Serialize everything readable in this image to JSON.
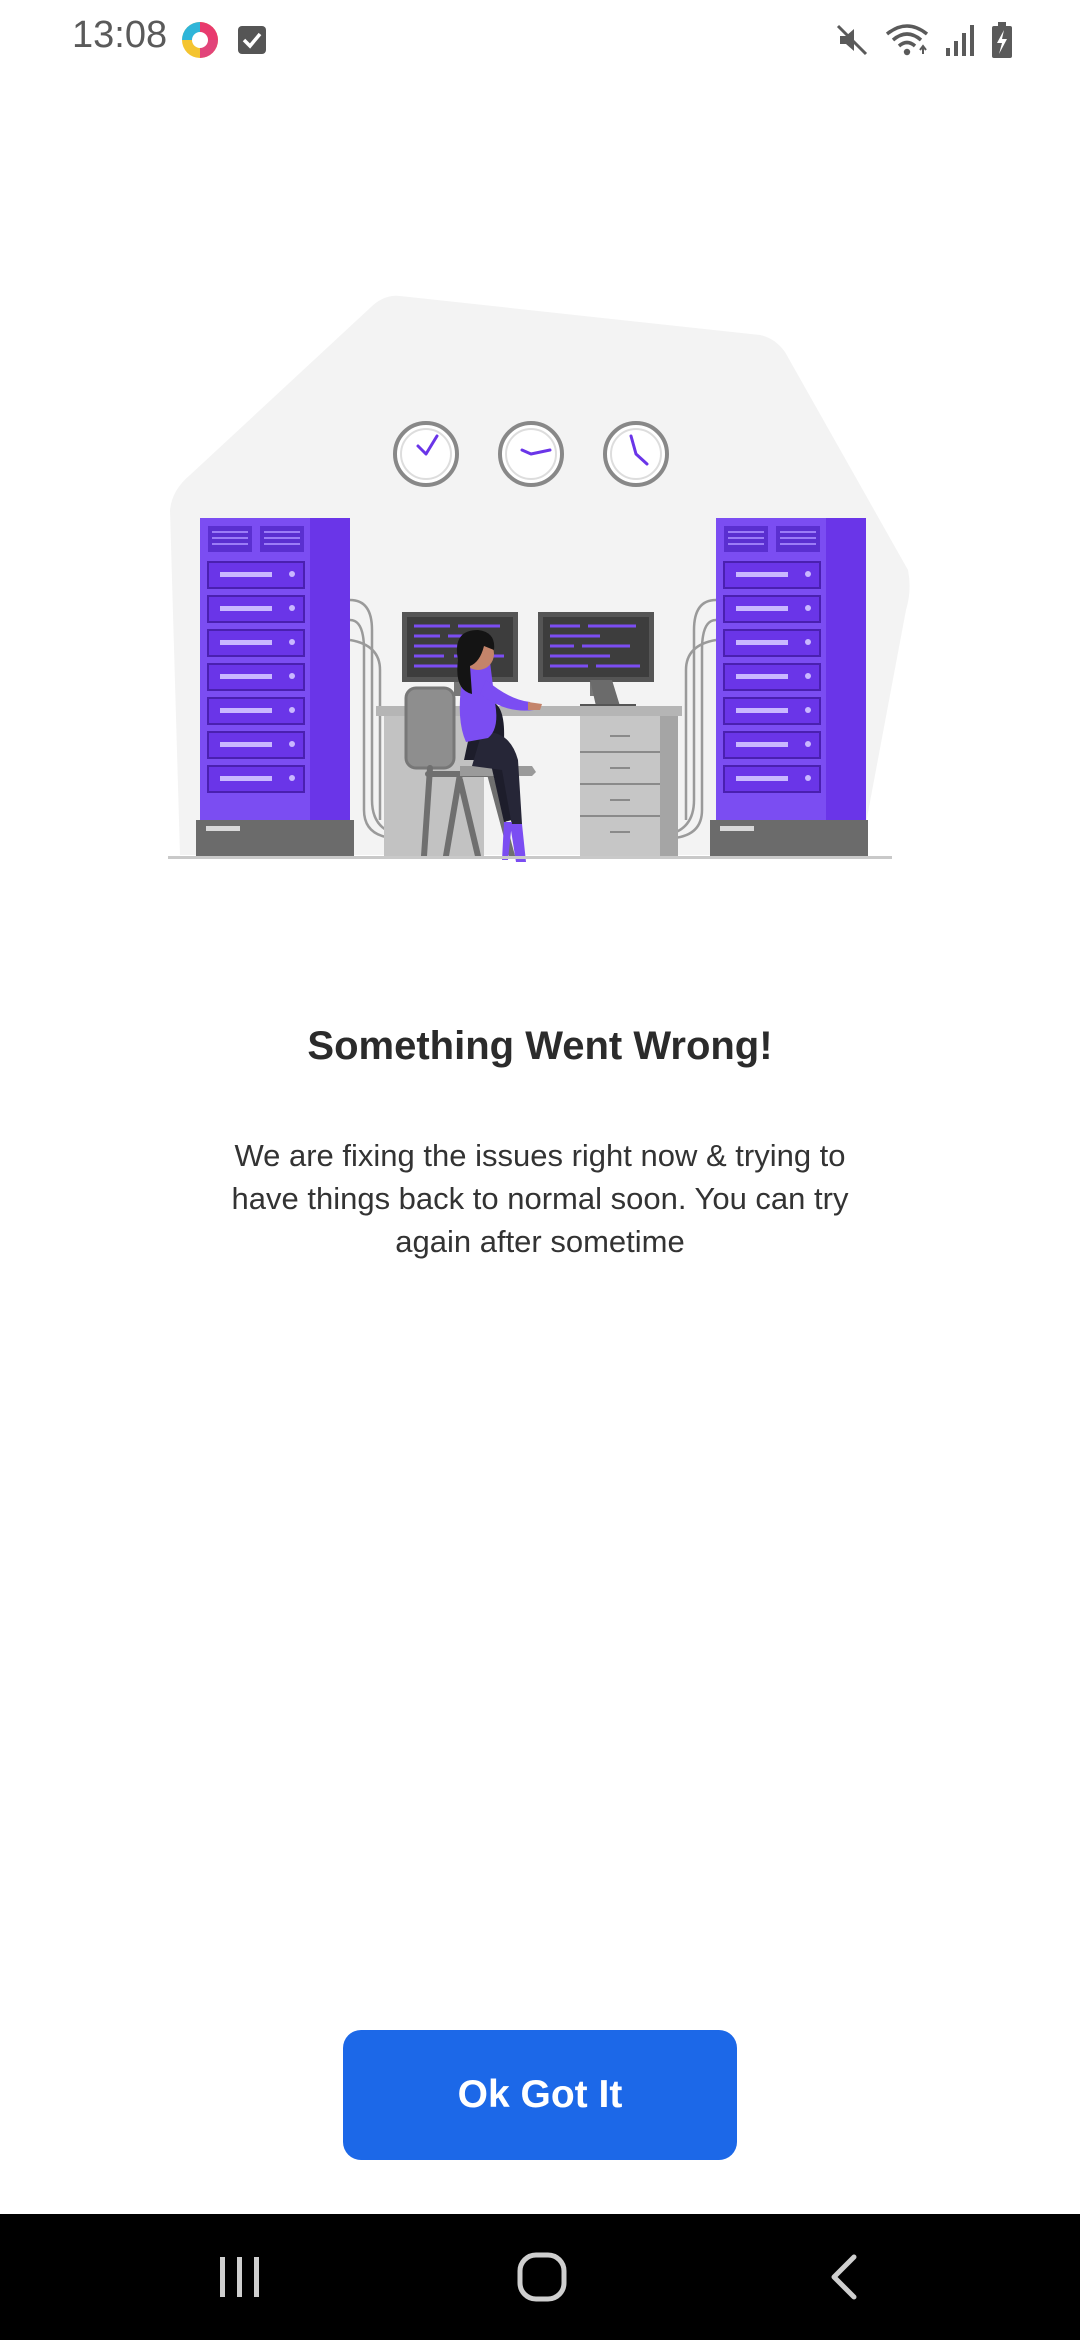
{
  "status_bar": {
    "time": "13:08",
    "icons": [
      "app-notification-icon",
      "checkbox-notification-icon",
      "mute-icon",
      "wifi-icon",
      "signal-icon",
      "battery-charging-icon"
    ]
  },
  "error": {
    "title": "Something Went Wrong!",
    "message": "We are fixing the issues right now & trying to have things back to normal soon. You can try again after sometime"
  },
  "actions": {
    "ok_label": "Ok Got It"
  },
  "nav_bar": {
    "icons": [
      "recent-apps-icon",
      "home-icon",
      "back-icon"
    ]
  },
  "colors": {
    "accent": "#1c68e8",
    "illustration_purple": "#7b4df2",
    "illustration_purple_dark": "#6a35e8",
    "nav_background": "#000000"
  }
}
